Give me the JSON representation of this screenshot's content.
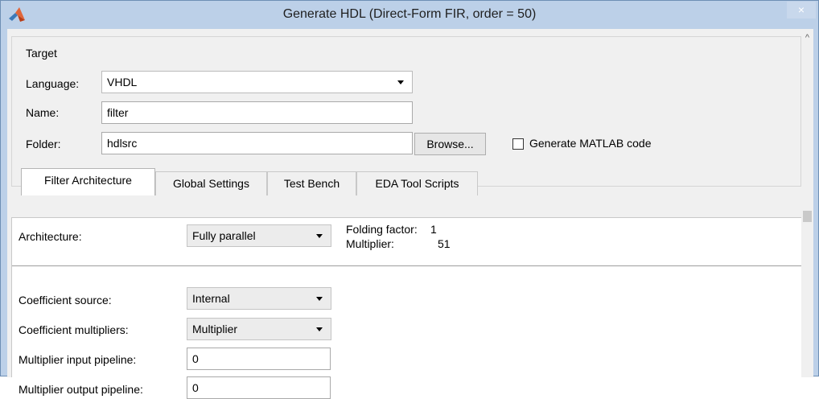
{
  "window": {
    "title": "Generate HDL (Direct-Form FIR, order = 50)",
    "close_glyph": "×",
    "app_icon": "matlab-logo-icon",
    "colors": {
      "titlebar": "#bcd0e8",
      "background": "#f0f0f0",
      "panel": "#ffffff"
    }
  },
  "target": {
    "group_label": "Target",
    "language_label": "Language:",
    "language_value": "VHDL",
    "name_label": "Name:",
    "name_value": "filter",
    "folder_label": "Folder:",
    "folder_value": "hdlsrc",
    "browse_label": "Browse...",
    "generate_matlab_label": "Generate MATLAB code",
    "generate_matlab_checked": false
  },
  "tabs": [
    {
      "label": "Filter Architecture",
      "active": true
    },
    {
      "label": "Global Settings",
      "active": false
    },
    {
      "label": "Test Bench",
      "active": false
    },
    {
      "label": "EDA Tool Scripts",
      "active": false
    }
  ],
  "filter_architecture": {
    "architecture_label": "Architecture:",
    "architecture_value": "Fully parallel",
    "folding_factor_label": "Folding factor:",
    "folding_factor_value": "1",
    "multiplier_label": "Multiplier:",
    "multiplier_value": "51",
    "coefficient_source_label": "Coefficient source:",
    "coefficient_source_value": "Internal",
    "coefficient_multipliers_label": "Coefficient multipliers:",
    "coefficient_multipliers_value": "Multiplier",
    "mult_input_pipeline_label": "Multiplier input pipeline:",
    "mult_input_pipeline_value": "0",
    "mult_output_pipeline_label": "Multiplier output pipeline:",
    "mult_output_pipeline_value": "0"
  },
  "scrollbar": {
    "up_glyph": "^"
  }
}
